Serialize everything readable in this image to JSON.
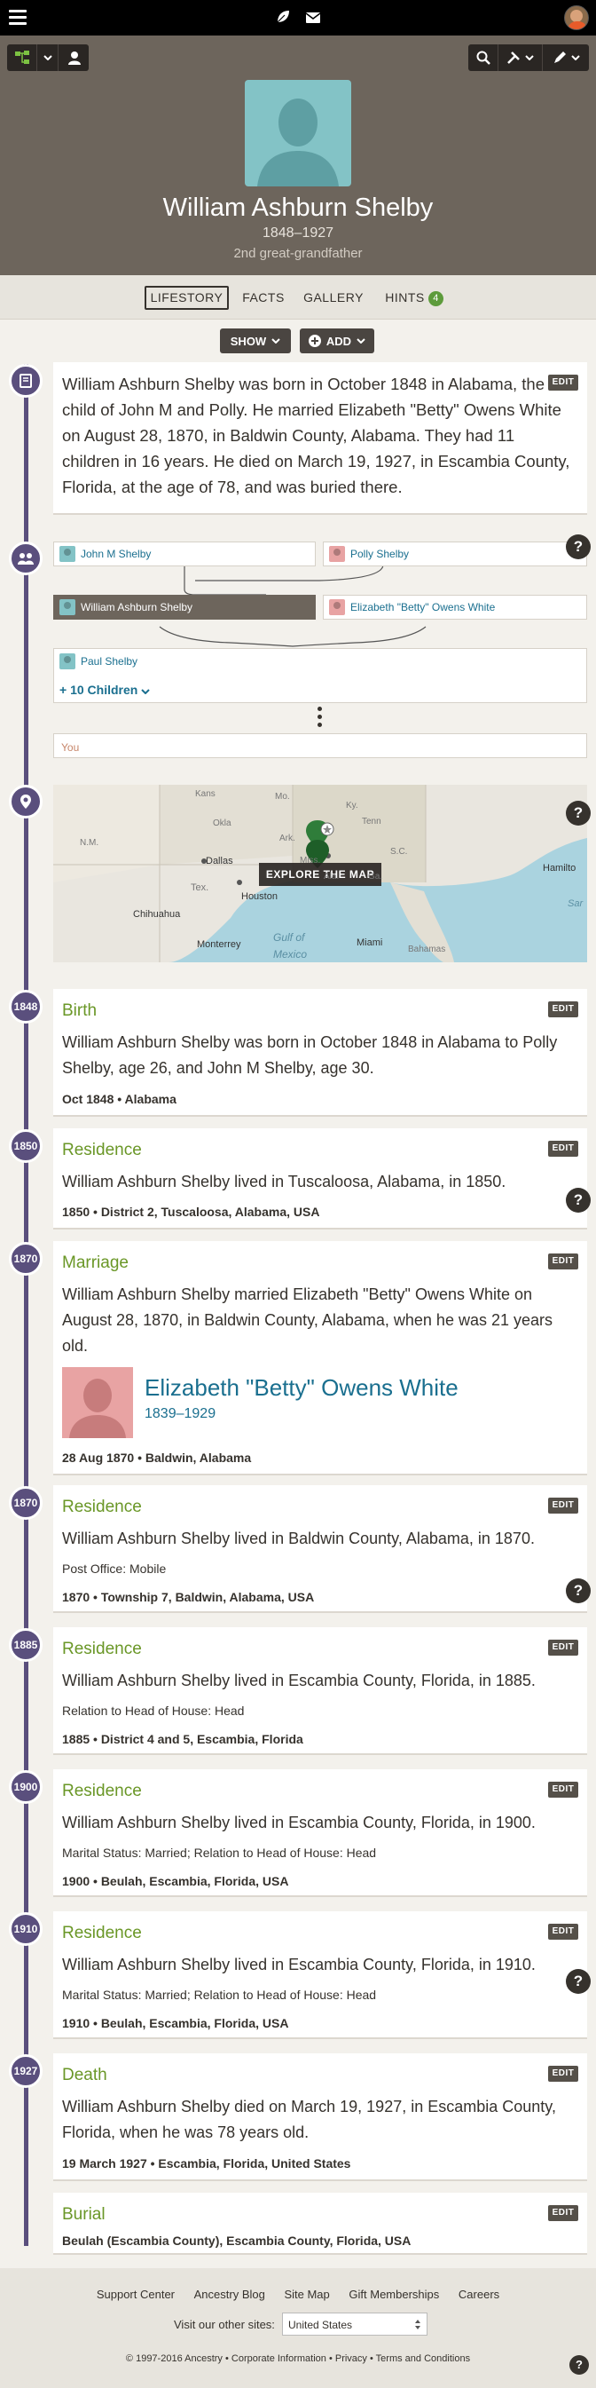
{
  "header": {
    "menu_icon": "hamburger-icon",
    "leaf_icon": "leaf-icon",
    "mail_icon": "mail-icon"
  },
  "person": {
    "name": "William Ashburn Shelby",
    "lifespan": "1848–1927",
    "relationship": "2nd great-grandfather"
  },
  "tabs": [
    {
      "label": "LIFESTORY",
      "active": true
    },
    {
      "label": "FACTS"
    },
    {
      "label": "GALLERY"
    },
    {
      "label": "HINTS",
      "badge": "4"
    }
  ],
  "actions": {
    "show": "SHOW",
    "add": "ADD"
  },
  "story": {
    "text": "William Ashburn Shelby was born in October 1848 in Alabama, the child of John M and Polly. He married Elizabeth \"Betty\" Owens White on August 28, 1870, in Baldwin County, Alabama. They had 11 children in 16 years. He died on March 19, 1927, in Escambia County, Florida, at the age of 78, and was buried there.",
    "edit": "EDIT"
  },
  "family": {
    "father": "John M Shelby",
    "mother": "Polly Shelby",
    "self": "William Ashburn Shelby",
    "spouse": "Elizabeth \"Betty\" Owens White",
    "child": "Paul Shelby",
    "more_children": "+ 10 Children",
    "you": "You"
  },
  "map": {
    "button": "EXPLORE THE MAP",
    "labels": [
      "Kans",
      "Mo.",
      "Ky.",
      "Tenn",
      "Okla",
      "N.M.",
      "Ark.",
      "S.C.",
      "Dallas",
      "Miss.",
      "Ala.",
      "Ga.",
      "Tex.",
      "Houston",
      "Hamilto",
      "Chihuahua",
      "Monterrey",
      "Gulf of",
      "Mexico",
      "Miami",
      "Bahamas",
      "Sar"
    ]
  },
  "events": [
    {
      "year": "1848",
      "title": "Birth",
      "text": "William Ashburn Shelby was born in October 1848 in Alabama to Polly Shelby, age 26, and John M Shelby, age 30.",
      "meta": "Oct 1848 • Alabama"
    },
    {
      "year": "1850",
      "title": "Residence",
      "text": "William Ashburn Shelby lived in Tuscaloosa, Alabama, in 1850.",
      "meta": "1850 • District 2, Tuscaloosa, Alabama, USA"
    },
    {
      "year": "1870",
      "title": "Marriage",
      "text": "William Ashburn Shelby married Elizabeth \"Betty\" Owens White on August 28, 1870, in Baldwin County, Alabama, when he was 21 years old.",
      "spouse_name": "Elizabeth \"Betty\" Owens White",
      "spouse_dates": "1839–1929",
      "meta": "28 Aug 1870 • Baldwin, Alabama"
    },
    {
      "year": "1870",
      "title": "Residence",
      "text": "William Ashburn Shelby lived in Baldwin County, Alabama, in 1870.",
      "sub": "Post Office: Mobile",
      "meta": "1870 • Township 7, Baldwin, Alabama, USA"
    },
    {
      "year": "1885",
      "title": "Residence",
      "text": "William Ashburn Shelby lived in Escambia County, Florida, in 1885.",
      "sub": "Relation to Head of House: Head",
      "meta": "1885 • District 4 and 5, Escambia, Florida"
    },
    {
      "year": "1900",
      "title": "Residence",
      "text": "William Ashburn Shelby lived in Escambia County, Florida, in 1900.",
      "sub": "Marital Status: Married; Relation to Head of House: Head",
      "meta": "1900 • Beulah, Escambia, Florida, USA"
    },
    {
      "year": "1910",
      "title": "Residence",
      "text": "William Ashburn Shelby lived in Escambia County, Florida, in 1910.",
      "sub": "Marital Status: Married; Relation to Head of House: Head",
      "meta": "1910 • Beulah, Escambia, Florida, USA"
    },
    {
      "year": "1927",
      "title": "Death",
      "text": "William Ashburn Shelby died on March 19, 1927, in Escambia County, Florida, when he was 78 years old.",
      "meta": "19 March 1927 • Escambia, Florida, United States"
    },
    {
      "title": "Burial",
      "meta": "Beulah (Escambia County), Escambia County, Florida, USA"
    }
  ],
  "edit_label": "EDIT",
  "help_label": "?",
  "footer": {
    "links": [
      "Support Center",
      "Ancestry Blog",
      "Site Map",
      "Gift Memberships",
      "Careers"
    ],
    "other_sites_label": "Visit our other sites:",
    "site_select": "United States",
    "copyright": "© 1997-2016 Ancestry • Corporate Information • Privacy • Terms and Conditions"
  },
  "colors": {
    "timeline": "#5a4f7d",
    "event_title": "#6a9727",
    "link": "#1a6f8f",
    "hero": "#6d655c"
  }
}
